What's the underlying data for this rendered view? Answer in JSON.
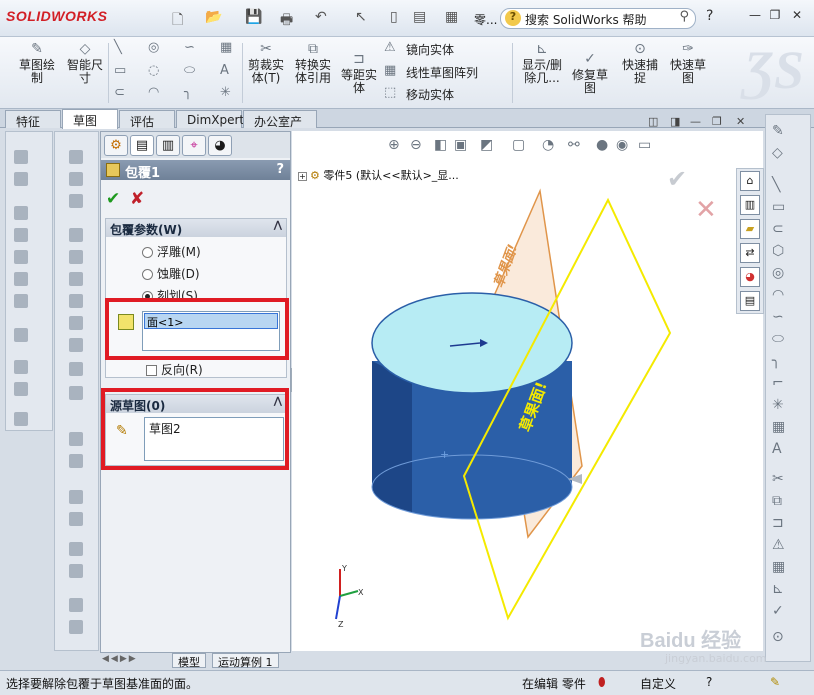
{
  "app": {
    "brand": "SOLIDWORKS",
    "search_placeholder": "搜索 SolidWorks 帮助",
    "ellipsis": "零...",
    "help_icon": "?",
    "min": "—",
    "restore": "❐",
    "close": "✕"
  },
  "commands": {
    "sketch": "草图绘\n制",
    "smart_dim": "智能尺\n寸",
    "trim": "剪裁实\n体(T)",
    "convert": "转换实\n体引用",
    "offset": "等距实\n体",
    "mirror": "镜向实体",
    "linear_pattern": "线性草图阵列",
    "move": "移动实体",
    "display_delete": "显示/删\n除几...",
    "repair": "修复草\n图",
    "quick_snap": "快速捕\n捉",
    "rapid_sketch": "快速草\n图"
  },
  "tabs": [
    "特征",
    "草图",
    "评估",
    "DimXpert",
    "办公室产品"
  ],
  "active_tab": 1,
  "property_manager": {
    "title": "包覆1",
    "help": "?",
    "group1_title": "包覆参数(W)",
    "options": [
      "浮雕(M)",
      "蚀雕(D)",
      "刻划(S)"
    ],
    "selected_option": 2,
    "face_item": "面<1>",
    "reverse": "反向(R)",
    "group2_title": "源草图(0)",
    "sketch_item": "草图2"
  },
  "tree": {
    "label": "零件5  (默认<<默认>_显..."
  },
  "model_text": {
    "label1": "草果面!",
    "label2": "草果面!"
  },
  "bottom_tabs": [
    "模型",
    "运动算例 1"
  ],
  "status": {
    "message": "选择要解除包覆于草图基准面的面。",
    "mode": "在编辑 零件",
    "custom": "自定义"
  },
  "watermark": {
    "brand": "Baidu 经验",
    "url": "jingyan.baidu.com"
  },
  "colors": {
    "accent": "#e01b24",
    "cylinder": "#2b5fa8",
    "plane_yellow": "#f4ea00",
    "plane_orange": "#e0954a"
  }
}
